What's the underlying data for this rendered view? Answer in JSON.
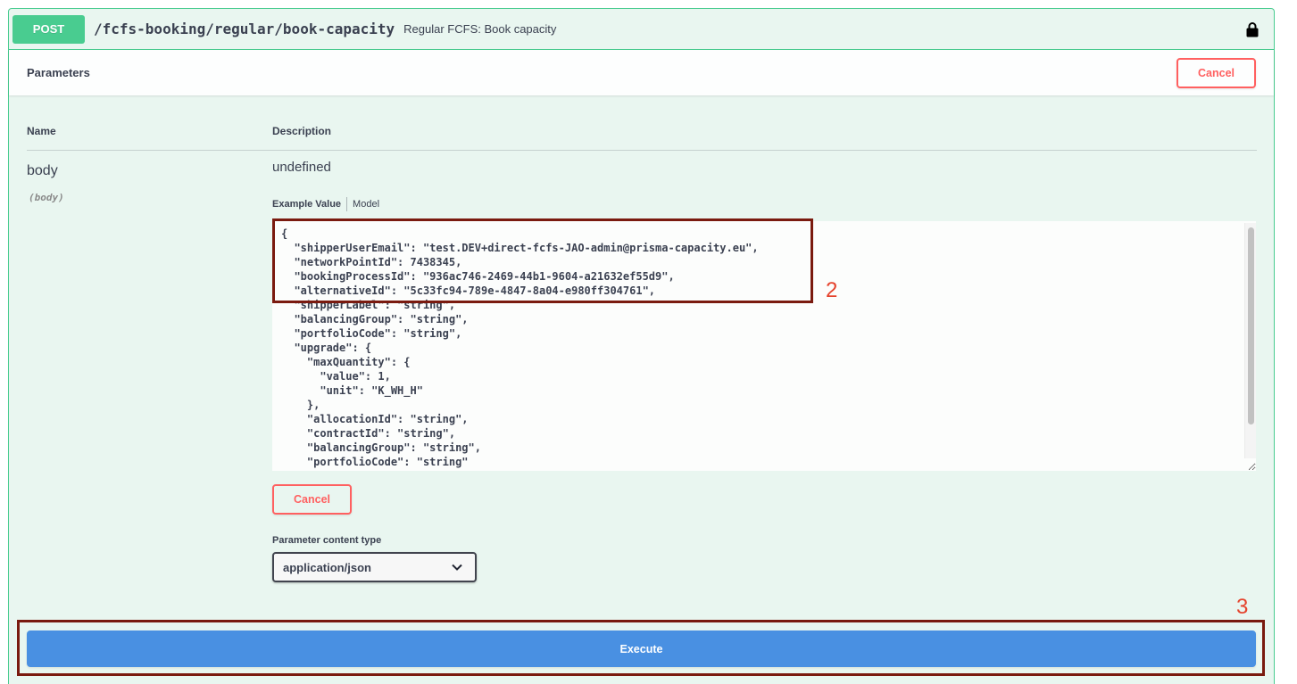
{
  "operation": {
    "method": "POST",
    "path": "/fcfs-booking/regular/book-capacity",
    "summary": "Regular FCFS: Book capacity",
    "icon": "lock-icon"
  },
  "parameters": {
    "title": "Parameters",
    "cancel_label": "Cancel",
    "columns": {
      "name": "Name",
      "description": "Description"
    },
    "rows": [
      {
        "name": "body",
        "location": "(body)",
        "description": "undefined"
      }
    ]
  },
  "body_editor": {
    "tabs": [
      "Example Value",
      "Model"
    ],
    "active_tab_index": 0,
    "value": "{\n  \"shipperUserEmail\": \"test.DEV+direct-fcfs-JAO-admin@prisma-capacity.eu\",\n  \"networkPointId\": 7438345,\n  \"bookingProcessId\": \"936ac746-2469-44b1-9604-a21632ef55d9\",\n  \"alternativeId\": \"5c33fc94-789e-4847-8a04-e980ff304761\",\n  \"shipperLabel\": \"string\",\n  \"balancingGroup\": \"string\",\n  \"portfolioCode\": \"string\",\n  \"upgrade\": {\n    \"maxQuantity\": {\n      \"value\": 1,\n      \"unit\": \"K_WH_H\"\n    },\n    \"allocationId\": \"string\",\n    \"contractId\": \"string\",\n    \"balancingGroup\": \"string\",\n    \"portfolioCode\": \"string\"",
    "cancel_label": "Cancel"
  },
  "content_type": {
    "label": "Parameter content type",
    "selected": "application/json",
    "icon": "chevron-down-icon"
  },
  "execute": {
    "label": "Execute"
  },
  "annotations": {
    "callout_2": "2",
    "callout_3": "3"
  },
  "colors": {
    "post_method": "#49cc90",
    "block_background": "#e9f6f0",
    "cancel": "#ff6060",
    "execute": "#4990e2",
    "annotation_box": "#7a1a0f",
    "annotation_label": "#e5432d",
    "text": "#3b4151"
  }
}
